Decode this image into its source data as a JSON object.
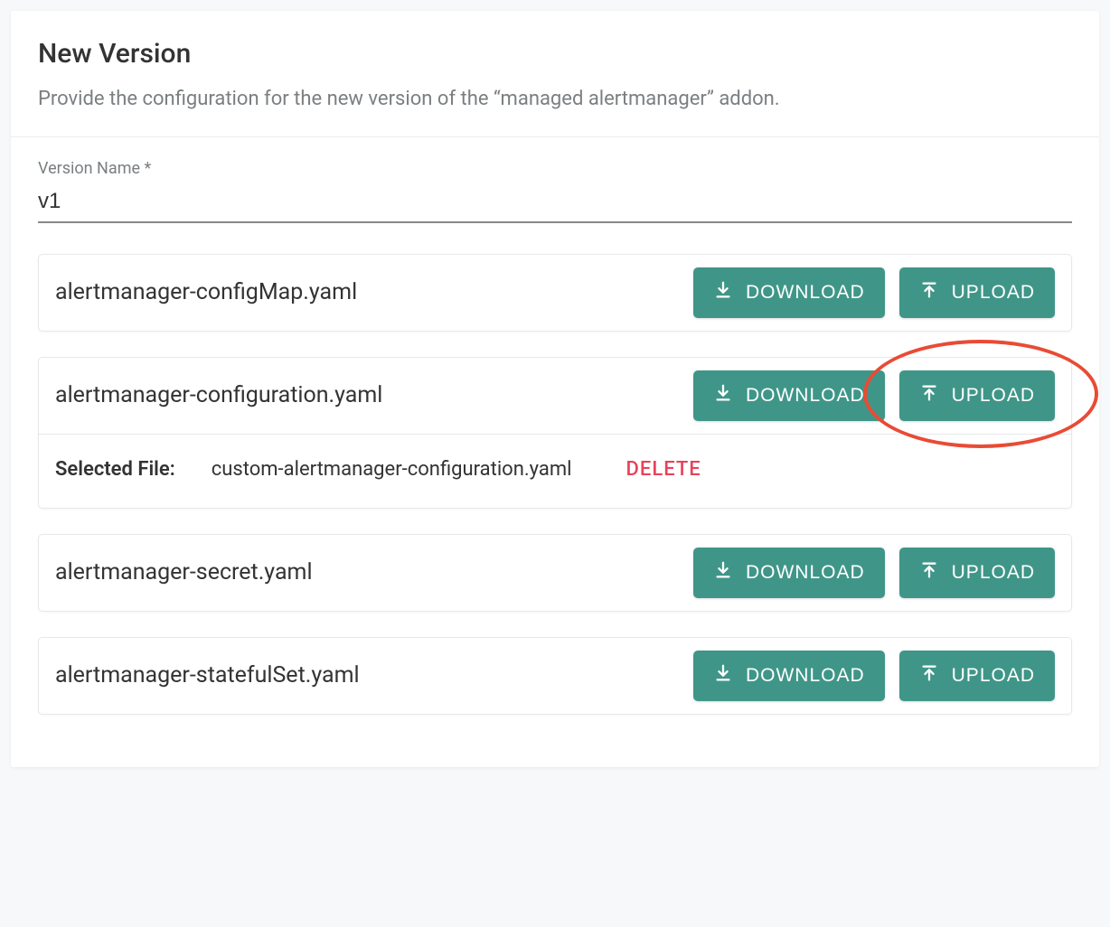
{
  "header": {
    "title": "New Version",
    "subtitle": "Provide the configuration for the new version of the “managed alertmanager” addon."
  },
  "form": {
    "version_name_label": "Version Name *",
    "version_name_value": "v1"
  },
  "buttons": {
    "download": "DOWNLOAD",
    "upload": "UPLOAD",
    "delete": "DELETE"
  },
  "selected_file_label": "Selected File:",
  "files": [
    {
      "name": "alertmanager-configMap.yaml",
      "selected_file": null,
      "highlight_upload": false
    },
    {
      "name": "alertmanager-configuration.yaml",
      "selected_file": "custom-alertmanager-configuration.yaml",
      "highlight_upload": true
    },
    {
      "name": "alertmanager-secret.yaml",
      "selected_file": null,
      "highlight_upload": false
    },
    {
      "name": "alertmanager-statefulSet.yaml",
      "selected_file": null,
      "highlight_upload": false
    }
  ],
  "colors": {
    "accent": "#3f9688",
    "danger": "#e9415b",
    "highlight": "#e94b35"
  }
}
